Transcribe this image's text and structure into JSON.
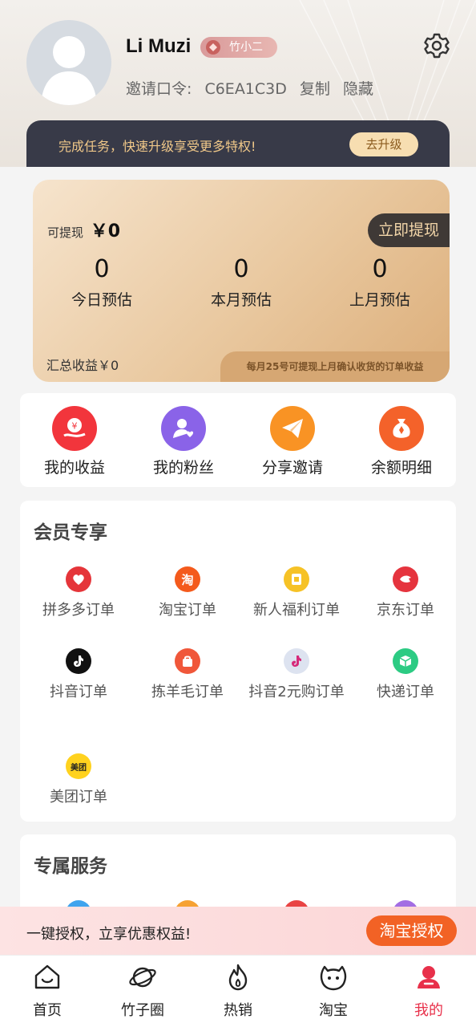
{
  "profile": {
    "username": "Li Muzi",
    "level": "竹小二",
    "invite_label": "邀请口令:",
    "invite_code": "C6EA1C3D",
    "copy_label": "复制",
    "hide_label": "隐藏"
  },
  "upgrade": {
    "text": "完成任务，快速升级享受更多特权!",
    "button": "去升级"
  },
  "earnings": {
    "withdrawable_label": "可提现",
    "withdrawable_value": "￥0",
    "withdraw_button": "立即提现",
    "stats": [
      {
        "value": "0",
        "label": "今日预估"
      },
      {
        "value": "0",
        "label": "本月预估"
      },
      {
        "value": "0",
        "label": "上月预估"
      }
    ],
    "total": "汇总收益￥0",
    "note": "每月25号可提现上月确认收货的订单收益"
  },
  "quick_menu": [
    {
      "label": "我的收益",
      "icon": "income-icon",
      "color": "#f2353c"
    },
    {
      "label": "我的粉丝",
      "icon": "fans-icon",
      "color": "#8a63e8"
    },
    {
      "label": "分享邀请",
      "icon": "share-icon",
      "color": "#f99324"
    },
    {
      "label": "余额明细",
      "icon": "balance-icon",
      "color": "#f4622a"
    }
  ],
  "member": {
    "title": "会员专享",
    "items": [
      {
        "label": "拼多多订单",
        "icon": "pinduoduo-icon",
        "color": "#e5353a"
      },
      {
        "label": "淘宝订单",
        "icon": "taobao-icon",
        "color": "#f45a1c"
      },
      {
        "label": "新人福利订单",
        "icon": "newcomer-icon",
        "color": "#f6c226"
      },
      {
        "label": "京东订单",
        "icon": "jd-icon",
        "color": "#e5343e"
      },
      {
        "label": "抖音订单",
        "icon": "douyin-icon",
        "color": "#111111"
      },
      {
        "label": "拣羊毛订单",
        "icon": "bag-icon",
        "color": "#f0573a"
      },
      {
        "label": "抖音2元购订单",
        "icon": "douyin-2yuan-icon",
        "color": "#dde3f0"
      },
      {
        "label": "快递订单",
        "icon": "express-icon",
        "color": "#2ccb83"
      },
      {
        "label": "美团订单",
        "icon": "meituan-icon",
        "color": "#ffd21e"
      }
    ]
  },
  "service": {
    "title": "专属服务"
  },
  "auth_banner": {
    "text": "一键授权，立享优惠权益!",
    "button": "淘宝授权"
  },
  "tabs": [
    {
      "label": "首页",
      "icon": "home-icon"
    },
    {
      "label": "竹子圈",
      "icon": "planet-icon"
    },
    {
      "label": "热销",
      "icon": "flame-icon"
    },
    {
      "label": "淘宝",
      "icon": "taobao-face-icon"
    },
    {
      "label": "我的",
      "icon": "profile-icon",
      "active": true
    }
  ],
  "colors": {
    "accent": "#e8304a",
    "auth_button": "#f26225",
    "upgrade_bar": "#383a48",
    "gold_text": "#f0c889"
  }
}
